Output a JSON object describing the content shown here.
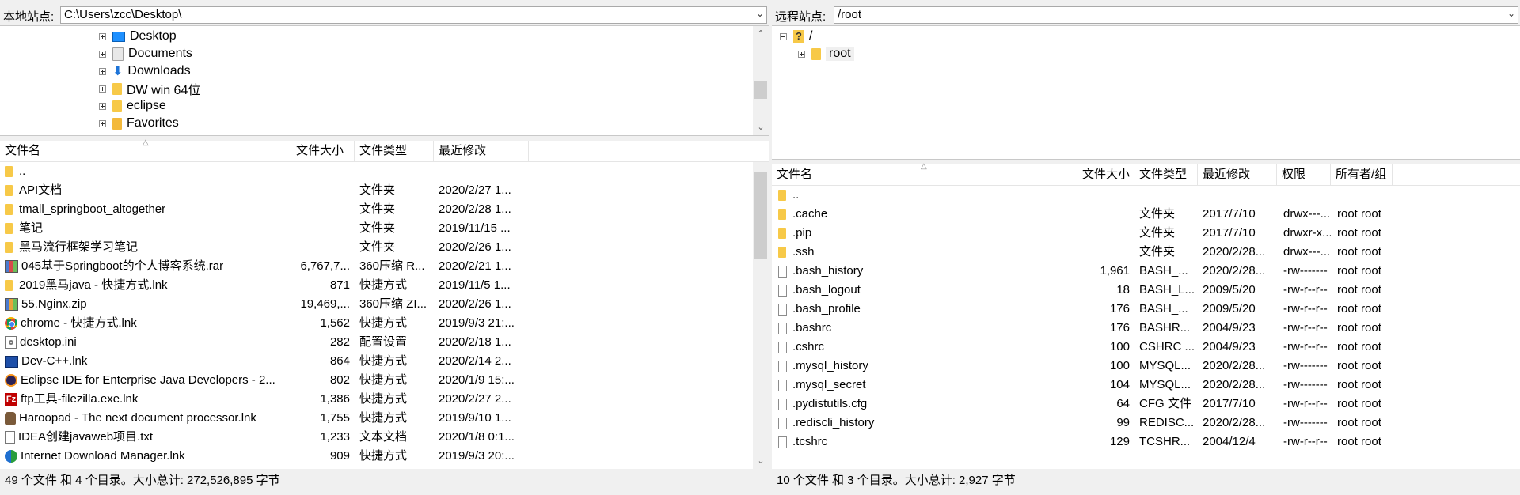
{
  "local": {
    "label": "本地站点:",
    "path": "C:\\Users\\zcc\\Desktop\\",
    "tree": [
      {
        "name": "Desktop",
        "icon": "desktop-icon",
        "selected": true
      },
      {
        "name": "Documents",
        "icon": "documents-icon"
      },
      {
        "name": "Downloads",
        "icon": "downloads-icon"
      },
      {
        "name": "DW win 64位",
        "icon": "folder-icon"
      },
      {
        "name": "eclipse",
        "icon": "folder-icon"
      },
      {
        "name": "Favorites",
        "icon": "favorites-icon"
      }
    ],
    "columns": [
      "文件名",
      "文件大小",
      "文件类型",
      "最近修改"
    ],
    "files": [
      {
        "name": "..",
        "size": "",
        "type": "",
        "modified": "",
        "icon": "folder-icon"
      },
      {
        "name": "API文档",
        "size": "",
        "type": "文件夹",
        "modified": "2020/2/27 1...",
        "icon": "folder-icon"
      },
      {
        "name": "tmall_springboot_altogether",
        "size": "",
        "type": "文件夹",
        "modified": "2020/2/28 1...",
        "icon": "folder-icon"
      },
      {
        "name": "笔记",
        "size": "",
        "type": "文件夹",
        "modified": "2019/11/15 ...",
        "icon": "folder-icon"
      },
      {
        "name": "黑马流行框架学习笔记",
        "size": "",
        "type": "文件夹",
        "modified": "2020/2/26 1...",
        "icon": "folder-icon"
      },
      {
        "name": "045基于Springboot的个人博客系统.rar",
        "size": "6,767,7...",
        "type": "360压缩 R...",
        "modified": "2020/2/21 1...",
        "icon": "rar-icon"
      },
      {
        "name": "2019黑马java - 快捷方式.lnk",
        "size": "871",
        "type": "快捷方式",
        "modified": "2019/11/5 1...",
        "icon": "folder-shortcut-icon"
      },
      {
        "name": "55.Nginx.zip",
        "size": "19,469,...",
        "type": "360压缩 ZI...",
        "modified": "2020/2/26 1...",
        "icon": "zip-icon"
      },
      {
        "name": "chrome - 快捷方式.lnk",
        "size": "1,562",
        "type": "快捷方式",
        "modified": "2019/9/3 21:...",
        "icon": "chrome-icon"
      },
      {
        "name": "desktop.ini",
        "size": "282",
        "type": "配置设置",
        "modified": "2020/2/18 1...",
        "icon": "settings-file-icon"
      },
      {
        "name": "Dev-C++.lnk",
        "size": "864",
        "type": "快捷方式",
        "modified": "2020/2/14 2...",
        "icon": "devcpp-icon"
      },
      {
        "name": "Eclipse IDE for Enterprise Java Developers - 2...",
        "size": "802",
        "type": "快捷方式",
        "modified": "2020/1/9 15:...",
        "icon": "eclipse-icon"
      },
      {
        "name": "ftp工具-filezilla.exe.lnk",
        "size": "1,386",
        "type": "快捷方式",
        "modified": "2020/2/27 2...",
        "icon": "filezilla-icon"
      },
      {
        "name": "Haroopad - The next document processor.lnk",
        "size": "1,755",
        "type": "快捷方式",
        "modified": "2019/9/10 1...",
        "icon": "haroopad-icon"
      },
      {
        "name": "IDEA创建javaweb项目.txt",
        "size": "1,233",
        "type": "文本文档",
        "modified": "2020/1/8 0:1...",
        "icon": "text-file-icon"
      },
      {
        "name": "Internet Download Manager.lnk",
        "size": "909",
        "type": "快捷方式",
        "modified": "2019/9/3 20:...",
        "icon": "idm-icon"
      }
    ],
    "status": "49 个文件 和 4 个目录。大小总计: 272,526,895 字节"
  },
  "remote": {
    "label": "远程站点:",
    "path": "/root",
    "tree": [
      {
        "name": "/",
        "icon": "unknown-folder-icon"
      },
      {
        "name": "root",
        "icon": "folder-icon",
        "selected": true
      }
    ],
    "columns": [
      "文件名",
      "文件大小",
      "文件类型",
      "最近修改",
      "权限",
      "所有者/组"
    ],
    "files": [
      {
        "name": "..",
        "size": "",
        "type": "",
        "modified": "",
        "perm": "",
        "owner": "",
        "icon": "folder-icon"
      },
      {
        "name": ".cache",
        "size": "",
        "type": "文件夹",
        "modified": "2017/7/10",
        "perm": "drwx---...",
        "owner": "root root",
        "icon": "folder-icon"
      },
      {
        "name": ".pip",
        "size": "",
        "type": "文件夹",
        "modified": "2017/7/10",
        "perm": "drwxr-x...",
        "owner": "root root",
        "icon": "folder-icon"
      },
      {
        "name": ".ssh",
        "size": "",
        "type": "文件夹",
        "modified": "2020/2/28...",
        "perm": "drwx---...",
        "owner": "root root",
        "icon": "folder-icon"
      },
      {
        "name": ".bash_history",
        "size": "1,961",
        "type": "BASH_...",
        "modified": "2020/2/28...",
        "perm": "-rw-------",
        "owner": "root root",
        "icon": "file-icon"
      },
      {
        "name": ".bash_logout",
        "size": "18",
        "type": "BASH_L...",
        "modified": "2009/5/20",
        "perm": "-rw-r--r--",
        "owner": "root root",
        "icon": "file-icon"
      },
      {
        "name": ".bash_profile",
        "size": "176",
        "type": "BASH_...",
        "modified": "2009/5/20",
        "perm": "-rw-r--r--",
        "owner": "root root",
        "icon": "file-icon"
      },
      {
        "name": ".bashrc",
        "size": "176",
        "type": "BASHR...",
        "modified": "2004/9/23",
        "perm": "-rw-r--r--",
        "owner": "root root",
        "icon": "file-icon"
      },
      {
        "name": ".cshrc",
        "size": "100",
        "type": "CSHRC ...",
        "modified": "2004/9/23",
        "perm": "-rw-r--r--",
        "owner": "root root",
        "icon": "file-icon"
      },
      {
        "name": ".mysql_history",
        "size": "100",
        "type": "MYSQL...",
        "modified": "2020/2/28...",
        "perm": "-rw-------",
        "owner": "root root",
        "icon": "file-icon"
      },
      {
        "name": ".mysql_secret",
        "size": "104",
        "type": "MYSQL...",
        "modified": "2020/2/28...",
        "perm": "-rw-------",
        "owner": "root root",
        "icon": "file-icon"
      },
      {
        "name": ".pydistutils.cfg",
        "size": "64",
        "type": "CFG 文件",
        "modified": "2017/7/10",
        "perm": "-rw-r--r--",
        "owner": "root root",
        "icon": "file-icon"
      },
      {
        "name": ".rediscli_history",
        "size": "99",
        "type": "REDISC...",
        "modified": "2020/2/28...",
        "perm": "-rw-------",
        "owner": "root root",
        "icon": "file-icon"
      },
      {
        "name": ".tcshrc",
        "size": "129",
        "type": "TCSHR...",
        "modified": "2004/12/4",
        "perm": "-rw-r--r--",
        "owner": "root root",
        "icon": "file-icon"
      }
    ],
    "status": "10 个文件 和 3 个目录。大小总计: 2,927 字节"
  }
}
